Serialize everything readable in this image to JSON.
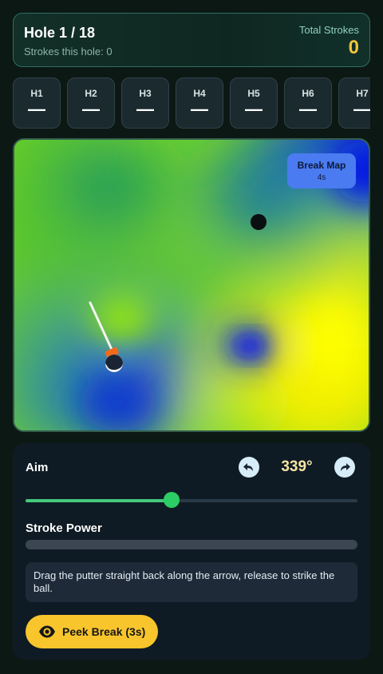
{
  "header": {
    "hole_title": "Hole 1 / 18",
    "strokes_this_hole": "Strokes this hole: 0",
    "total_label": "Total Strokes",
    "total_value": "0"
  },
  "holes": [
    {
      "label": "H1",
      "value": "—"
    },
    {
      "label": "H2",
      "value": "—"
    },
    {
      "label": "H3",
      "value": "—"
    },
    {
      "label": "H4",
      "value": "—"
    },
    {
      "label": "H5",
      "value": "—"
    },
    {
      "label": "H6",
      "value": "—"
    },
    {
      "label": "H7",
      "value": "—"
    }
  ],
  "green": {
    "break_map_label": "Break Map",
    "break_map_timer": "4s",
    "icons": [
      "hole-cup",
      "golf-ball",
      "putter-head",
      "aim-arrow"
    ]
  },
  "controls": {
    "aim_label": "Aim",
    "rotate_left_icon": "rotate-left-icon",
    "rotate_right_icon": "rotate-right-icon",
    "angle_display": "339°",
    "aim_slider_fraction": 0.44,
    "stroke_power_label": "Stroke Power",
    "stroke_power_fraction": 0,
    "hint": "Drag the putter straight back along the arrow, release to strike the ball.",
    "peek_button_label": "Peek Break (3s)",
    "peek_icon": "eye-icon"
  },
  "colors": {
    "accent_yellow": "#f2c43a",
    "slider_green": "#2ccd65",
    "break_button": "#4a7bf0"
  }
}
